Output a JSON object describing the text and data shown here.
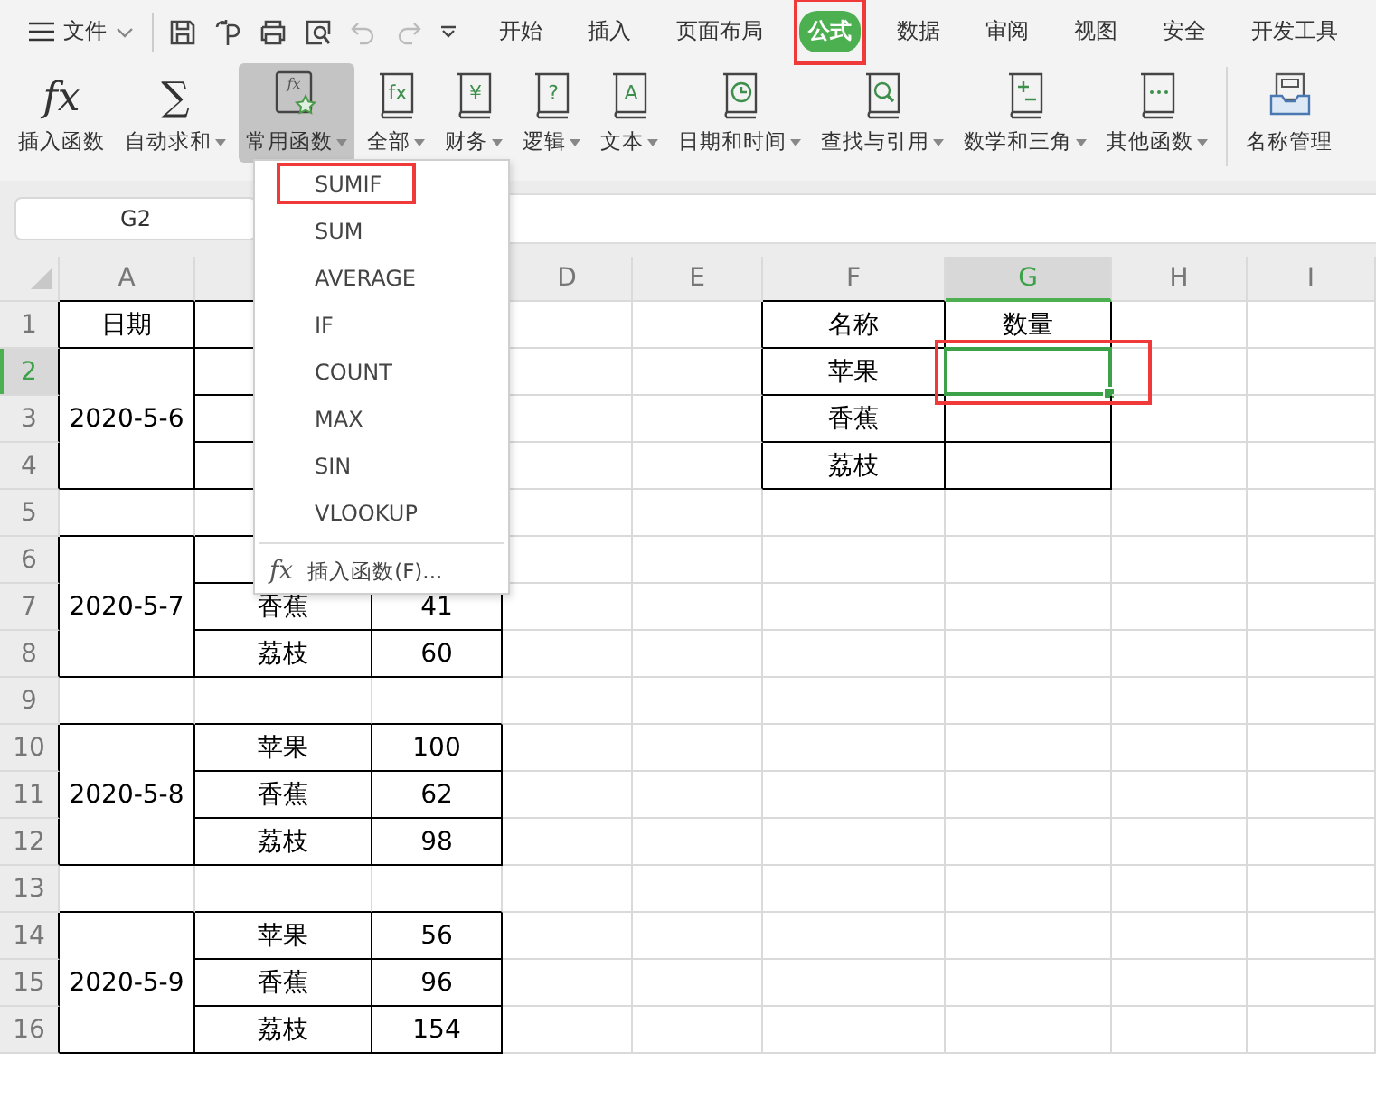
{
  "menu_bar": {
    "file_label": "文件",
    "quick_access": [
      {
        "kind": "save",
        "disabled": false
      },
      {
        "kind": "format",
        "disabled": false
      },
      {
        "kind": "print",
        "disabled": false
      },
      {
        "kind": "preview",
        "disabled": false
      },
      {
        "kind": "undo",
        "disabled": true
      },
      {
        "kind": "redo",
        "disabled": true
      }
    ],
    "tabs": [
      {
        "label": "开始",
        "selected": false,
        "annotated": false
      },
      {
        "label": "插入",
        "selected": false,
        "annotated": false
      },
      {
        "label": "页面布局",
        "selected": false,
        "annotated": false
      },
      {
        "label": "公式",
        "selected": true,
        "annotated": true
      },
      {
        "label": "数据",
        "selected": false,
        "annotated": false
      },
      {
        "label": "审阅",
        "selected": false,
        "annotated": false
      },
      {
        "label": "视图",
        "selected": false,
        "annotated": false
      },
      {
        "label": "安全",
        "selected": false,
        "annotated": false
      },
      {
        "label": "开发工具",
        "selected": false,
        "annotated": false
      }
    ]
  },
  "ribbon": [
    {
      "label": "插入函数",
      "kind": "glyph",
      "glyph": "fx",
      "dropdown": false,
      "pressed": false
    },
    {
      "label": "自动求和",
      "kind": "glyph",
      "glyph": "∑",
      "dropdown": true,
      "pressed": false
    },
    {
      "label": "常用函数",
      "kind": "star",
      "glyph": "fx",
      "dropdown": true,
      "pressed": true
    },
    {
      "label": "全部",
      "kind": "book",
      "glyph": "fx",
      "dropdown": true,
      "pressed": false
    },
    {
      "label": "财务",
      "kind": "book",
      "glyph": "¥",
      "dropdown": true,
      "pressed": false
    },
    {
      "label": "逻辑",
      "kind": "book",
      "glyph": "?",
      "dropdown": true,
      "pressed": false
    },
    {
      "label": "文本",
      "kind": "book",
      "glyph": "A",
      "dropdown": true,
      "pressed": false
    },
    {
      "label": "日期和时间",
      "kind": "clock",
      "dropdown": true,
      "pressed": false
    },
    {
      "label": "查找与引用",
      "kind": "search",
      "dropdown": true,
      "pressed": false
    },
    {
      "label": "数学和三角",
      "kind": "math",
      "dropdown": true,
      "pressed": false
    },
    {
      "label": "其他函数",
      "kind": "more",
      "dropdown": true,
      "pressed": false
    },
    {
      "label": "名称管理",
      "kind": "tray",
      "dropdown": false,
      "pressed": false
    }
  ],
  "name_box": "G2",
  "function_menu": {
    "items": [
      {
        "label": "SUMIF",
        "annotated": true
      },
      {
        "label": "SUM",
        "annotated": false
      },
      {
        "label": "AVERAGE",
        "annotated": false
      },
      {
        "label": "IF",
        "annotated": false
      },
      {
        "label": "COUNT",
        "annotated": false
      },
      {
        "label": "MAX",
        "annotated": false
      },
      {
        "label": "SIN",
        "annotated": false
      },
      {
        "label": "VLOOKUP",
        "annotated": false
      }
    ],
    "footer": {
      "glyph": "fx",
      "label": "插入函数(F)..."
    }
  },
  "sheet": {
    "columns": [
      {
        "label": "A",
        "selected": false
      },
      {
        "label": "D",
        "selected": false
      },
      {
        "label": "E",
        "selected": false
      },
      {
        "label": "F",
        "selected": false
      },
      {
        "label": "G",
        "selected": true
      },
      {
        "label": "H",
        "selected": false
      },
      {
        "label": "I",
        "selected": false
      }
    ],
    "rows": [
      {
        "number": "1",
        "selected": false
      },
      {
        "number": "2",
        "selected": true
      },
      {
        "number": "3",
        "selected": false
      },
      {
        "number": "4",
        "selected": false
      },
      {
        "number": "5",
        "selected": false
      },
      {
        "number": "6",
        "selected": false
      },
      {
        "number": "7",
        "selected": false
      },
      {
        "number": "8",
        "selected": false
      },
      {
        "number": "9",
        "selected": false
      },
      {
        "number": "10",
        "selected": false
      },
      {
        "number": "11",
        "selected": false
      },
      {
        "number": "12",
        "selected": false
      },
      {
        "number": "13",
        "selected": false
      },
      {
        "number": "14",
        "selected": false
      },
      {
        "number": "15",
        "selected": false
      },
      {
        "number": "16",
        "selected": false
      }
    ],
    "date_table": {
      "header": "日期",
      "groups": [
        {
          "date": "2020-5-6"
        },
        {
          "date": "2020-5-7",
          "items": [
            {
              "name": "香蕉",
              "qty": "41"
            },
            {
              "name": "荔枝",
              "qty": "60"
            }
          ]
        },
        {
          "date": "2020-5-8",
          "items": [
            {
              "name": "苹果",
              "qty": "100"
            },
            {
              "name": "香蕉",
              "qty": "62"
            },
            {
              "name": "荔枝",
              "qty": "98"
            }
          ]
        },
        {
          "date": "2020-5-9",
          "items": [
            {
              "name": "苹果",
              "qty": "56"
            },
            {
              "name": "香蕉",
              "qty": "96"
            },
            {
              "name": "荔枝",
              "qty": "154"
            }
          ]
        }
      ]
    },
    "lookup_table": {
      "headers": [
        "名称",
        "数量"
      ],
      "rows": [
        {
          "name": "苹果",
          "selected": true,
          "annotated": true
        },
        {
          "name": "香蕉",
          "selected": false,
          "annotated": false
        },
        {
          "name": "荔枝",
          "selected": false,
          "annotated": false
        }
      ]
    }
  }
}
